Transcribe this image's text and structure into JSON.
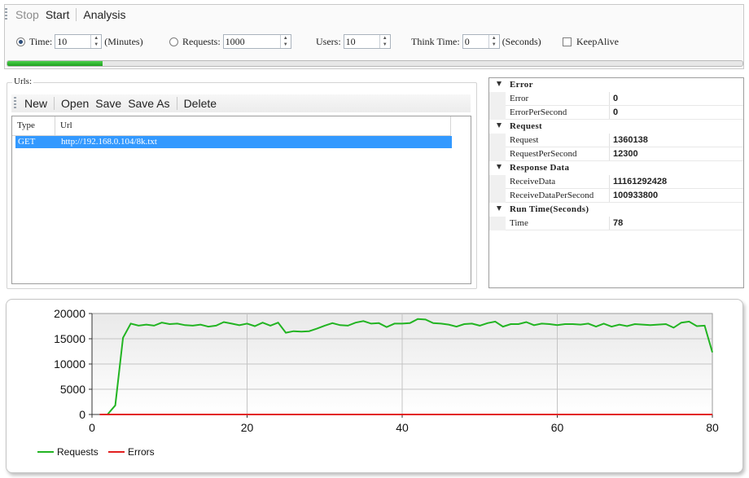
{
  "toolbar": {
    "stop": "Stop",
    "start": "Start",
    "analysis": "Analysis"
  },
  "options": {
    "time_label": "Time:",
    "time_value": "10",
    "time_unit": "(Minutes)",
    "requests_label": "Requests:",
    "requests_value": "1000",
    "users_label": "Users:",
    "users_value": "10",
    "think_label": "Think Time:",
    "think_value": "0",
    "think_unit": "(Seconds)",
    "keepalive_label": "KeepAlive",
    "selected_mode": "Time"
  },
  "progress": {
    "fraction": 0.13,
    "color": "#2bb52b"
  },
  "urls": {
    "title": "Urls:",
    "toolbar": {
      "new": "New",
      "open": "Open",
      "save": "Save",
      "save_as": "Save As",
      "delete": "Delete"
    },
    "columns": {
      "type": "Type",
      "url": "Url"
    },
    "rows": [
      {
        "type": "GET",
        "url": "http://192.168.0.104/8k.txt"
      }
    ]
  },
  "properties": [
    {
      "category": "Error",
      "items": [
        {
          "name": "Error",
          "value": "0"
        },
        {
          "name": "ErrorPerSecond",
          "value": "0"
        }
      ]
    },
    {
      "category": "Request",
      "items": [
        {
          "name": "Request",
          "value": "1360138"
        },
        {
          "name": "RequestPerSecond",
          "value": "12300"
        }
      ]
    },
    {
      "category": "Response Data",
      "items": [
        {
          "name": "ReceiveData",
          "value": "11161292428"
        },
        {
          "name": "ReceiveDataPerSecond",
          "value": "100933800"
        }
      ]
    },
    {
      "category": "Run Time(Seconds)",
      "items": [
        {
          "name": "Time",
          "value": "78"
        }
      ]
    }
  ],
  "chart_data": {
    "type": "line",
    "xlim": [
      0,
      80
    ],
    "ylim": [
      0,
      20000
    ],
    "xticks": [
      "0",
      "20",
      "40",
      "60",
      "80"
    ],
    "yticks": [
      "0",
      "5000",
      "10000",
      "15000",
      "20000"
    ],
    "grid": true,
    "legend_position": "bottom-left",
    "x": [
      1,
      2,
      3,
      4,
      5,
      6,
      7,
      8,
      9,
      10,
      11,
      12,
      13,
      14,
      15,
      16,
      17,
      18,
      19,
      20,
      21,
      22,
      23,
      24,
      25,
      26,
      27,
      28,
      29,
      30,
      31,
      32,
      33,
      34,
      35,
      36,
      37,
      38,
      39,
      40,
      41,
      42,
      43,
      44,
      45,
      46,
      47,
      48,
      49,
      50,
      51,
      52,
      53,
      54,
      55,
      56,
      57,
      58,
      59,
      60,
      61,
      62,
      63,
      64,
      65,
      66,
      67,
      68,
      69,
      70,
      71,
      72,
      73,
      74,
      75,
      76,
      77,
      78,
      79,
      80
    ],
    "series": [
      {
        "name": "Requests",
        "color": "#22b422",
        "values": [
          0,
          0,
          1800,
          15200,
          18000,
          17600,
          17800,
          17600,
          18200,
          17900,
          18000,
          17700,
          17600,
          17800,
          17400,
          17600,
          18300,
          18000,
          17700,
          18000,
          17500,
          18200,
          17600,
          18200,
          16200,
          16500,
          16400,
          16500,
          17000,
          17600,
          18100,
          17700,
          17600,
          18200,
          18500,
          18000,
          18100,
          17300,
          18000,
          18000,
          18100,
          18900,
          18800,
          18100,
          18000,
          17800,
          17400,
          17900,
          18000,
          17600,
          18100,
          18400,
          17400,
          17900,
          17900,
          18300,
          17700,
          18000,
          17900,
          17700,
          17900,
          17900,
          17800,
          18000,
          17400,
          18000,
          17400,
          17800,
          17500,
          17900,
          17800,
          17700,
          17800,
          17900,
          17200,
          18200,
          18400,
          17500,
          17600,
          12300
        ]
      },
      {
        "name": "Errors",
        "color": "#e21f1f",
        "values": [
          0,
          0,
          0,
          0,
          0,
          0,
          0,
          0,
          0,
          0,
          0,
          0,
          0,
          0,
          0,
          0,
          0,
          0,
          0,
          0,
          0,
          0,
          0,
          0,
          0,
          0,
          0,
          0,
          0,
          0,
          0,
          0,
          0,
          0,
          0,
          0,
          0,
          0,
          0,
          0,
          0,
          0,
          0,
          0,
          0,
          0,
          0,
          0,
          0,
          0,
          0,
          0,
          0,
          0,
          0,
          0,
          0,
          0,
          0,
          0,
          0,
          0,
          0,
          0,
          0,
          0,
          0,
          0,
          0,
          0,
          0,
          0,
          0,
          0,
          0,
          0,
          0,
          0,
          0,
          0
        ]
      }
    ]
  }
}
